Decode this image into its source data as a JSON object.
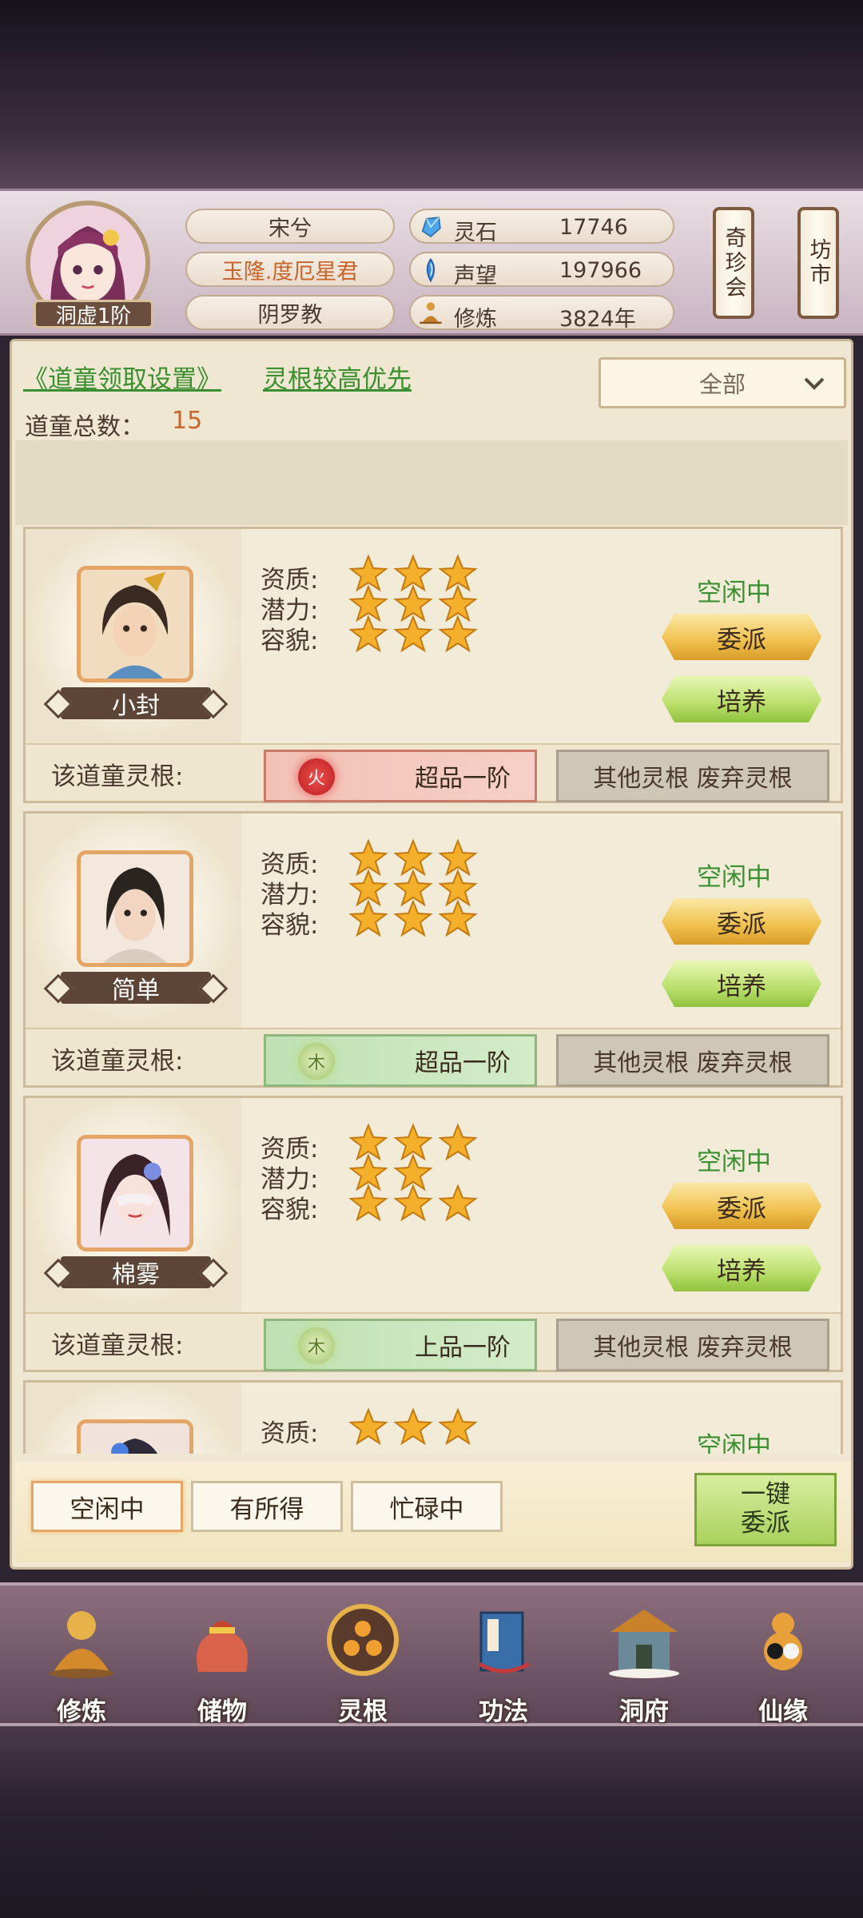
{
  "header": {
    "realm": "洞虚1阶",
    "name": "宋兮",
    "title": "玉隆.度厄星君",
    "sect": "阴罗教",
    "resources": [
      {
        "icon": "spirit-stone-icon",
        "label": "灵石",
        "value": "17746"
      },
      {
        "icon": "prestige-icon",
        "label": "声望",
        "value": "197966"
      },
      {
        "icon": "meditation-icon",
        "label": "修炼",
        "value": "3824年"
      }
    ],
    "side_buttons": {
      "qizhen": "奇珍会",
      "fangshi": "坊市"
    }
  },
  "panel": {
    "settings_link": "《道童领取设置》",
    "priority_link": "灵根较高优先",
    "filter_value": "全部",
    "total_label": "道童总数：",
    "total_value": "15"
  },
  "labels": {
    "aptitude": "资质:",
    "potential": "潜力:",
    "appearance": "容貌:",
    "root_label": "该道童灵根:",
    "assign": "委派",
    "train": "培养",
    "other_roots": "其他灵根 废弃灵根"
  },
  "children": [
    {
      "name": "小封",
      "status": "空闲中",
      "aptitude": 3,
      "potential": 3,
      "appearance": 3,
      "element": "火",
      "element_type": "fire",
      "root_grade": "超品一阶"
    },
    {
      "name": "简单",
      "status": "空闲中",
      "aptitude": 3,
      "potential": 3,
      "appearance": 3,
      "element": "木",
      "element_type": "wood",
      "root_grade": "超品一阶"
    },
    {
      "name": "棉雾",
      "status": "空闲中",
      "aptitude": 3,
      "potential": 2,
      "appearance": 3,
      "element": "木",
      "element_type": "wood",
      "root_grade": "上品一阶"
    },
    {
      "status": "空闲中",
      "aptitude": 3
    }
  ],
  "tabs": {
    "idle": "空闲中",
    "gained": "有所得",
    "busy": "忙碌中"
  },
  "one_key": {
    "line1": "一键",
    "line2": "委派"
  },
  "nav": [
    {
      "label": "修炼",
      "icon": "cultivate-icon"
    },
    {
      "label": "储物",
      "icon": "storage-bag-icon"
    },
    {
      "label": "灵根",
      "icon": "spirit-root-icon"
    },
    {
      "label": "功法",
      "icon": "skill-book-icon"
    },
    {
      "label": "洞府",
      "icon": "cave-mansion-icon"
    },
    {
      "label": "仙缘",
      "icon": "gourd-fate-icon"
    }
  ],
  "colors": {
    "green_text": "#3a8f2f",
    "orange_text": "#c9642a",
    "gold_button": "#f0c04c",
    "green_button": "#b9df6a"
  }
}
